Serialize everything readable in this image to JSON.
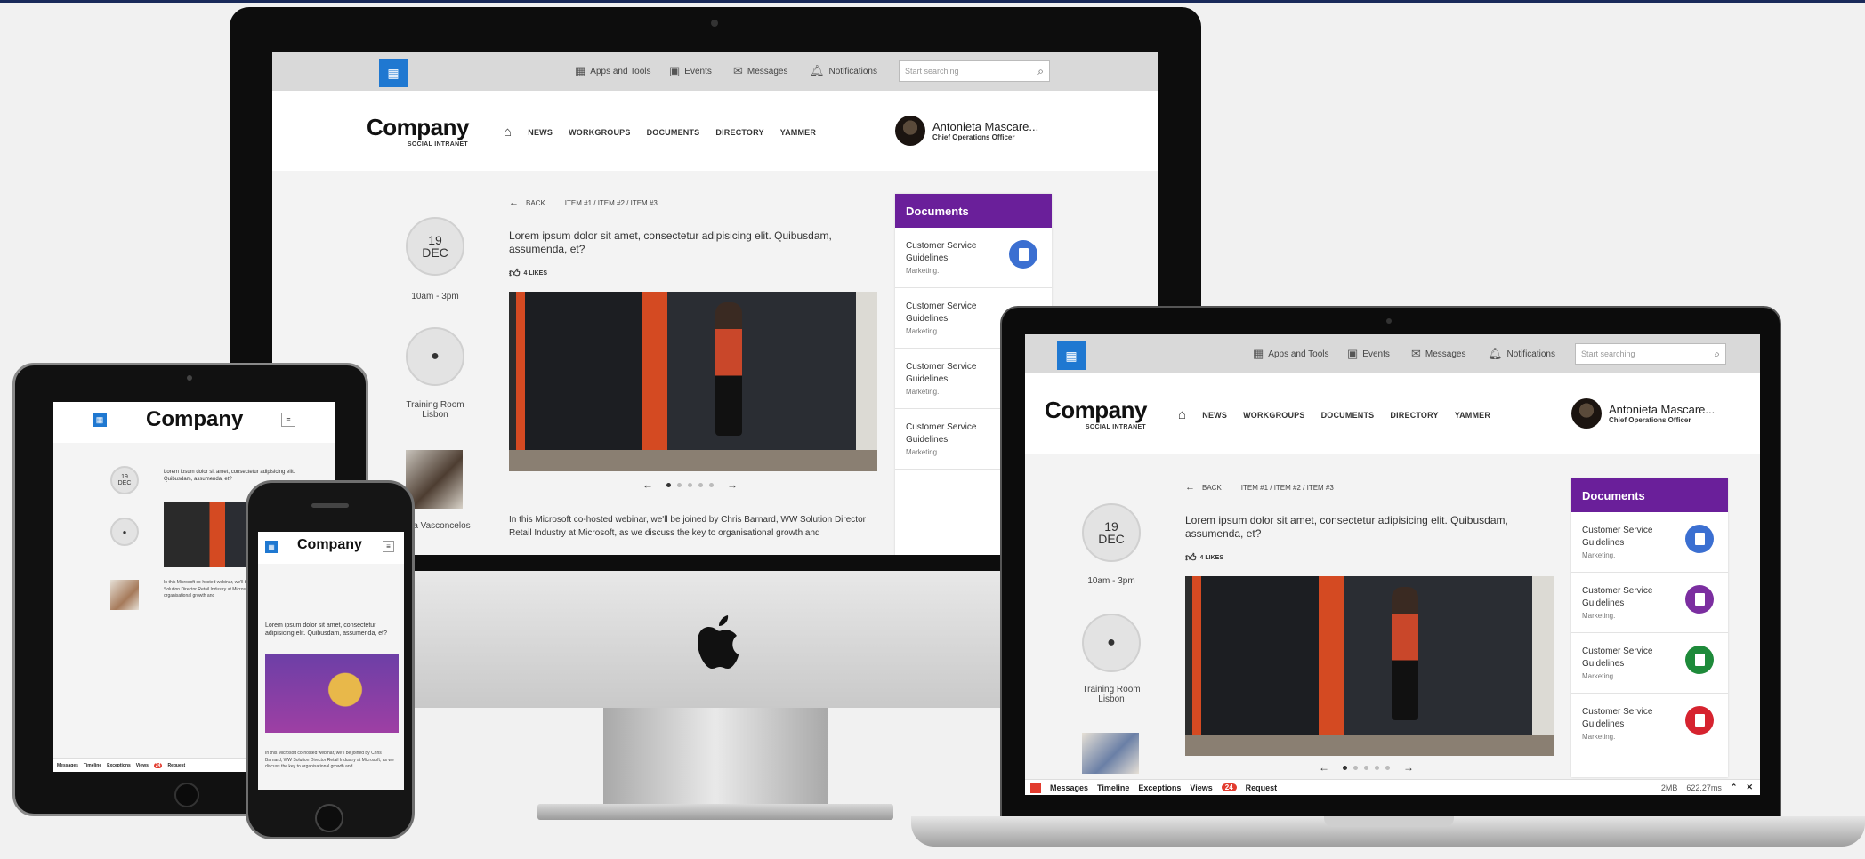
{
  "site": {
    "nav_util": {
      "apps_label": "Apps and Tools",
      "events_label": "Events",
      "messages_label": "Messages",
      "notifications_label": "Notifications",
      "search_placeholder": "Start searching"
    },
    "brand": {
      "title": "Company",
      "subtitle": "SOCIAL INTRANET"
    },
    "nav": [
      "NEWS",
      "WORKGROUPS",
      "DOCUMENTS",
      "DIRECTORY",
      "YAMMER"
    ],
    "profile": {
      "name": "Antonieta Mascare...",
      "role": "Chief Operations Officer"
    },
    "event": {
      "day": "19",
      "month": "DEC",
      "time": "10am - 3pm",
      "location": "Training Room\nLisbon"
    },
    "breadcrumb": {
      "back": "BACK",
      "path": "ITEM #1 / ITEM #2 / ITEM #3"
    },
    "headline": "Lorem ipsum dolor sit amet, consectetur adipisicing elit. Quibusdam, assumenda, et?",
    "likes": "4 LIKES",
    "body_text": "In this Microsoft co-hosted webinar, we'll be joined by Chris Barnard, WW Solution Director Retail Industry at Microsoft, as we discuss the key to organisational growth and",
    "person_partial": "ata Vasconcelos",
    "documents": {
      "title": "Documents",
      "items": [
        {
          "title": "Customer Service Guidelines",
          "category": "Marketing.",
          "color": "#3b6fd1"
        },
        {
          "title": "Customer Service Guidelines",
          "category": "Marketing.",
          "color": "#7b2ea0"
        },
        {
          "title": "Customer Service Guidelines",
          "category": "Marketing.",
          "color": "#1e8a3a"
        },
        {
          "title": "Customer Service Guidelines",
          "category": "Marketing.",
          "color": "#d6232f"
        }
      ]
    },
    "debug": {
      "messages": "Messages",
      "timeline": "Timeline",
      "exceptions": "Exceptions",
      "views": "Views",
      "views_count": "24",
      "request": "Request",
      "memory": "2MB",
      "time": "622.27ms"
    }
  },
  "accent_colors": {
    "grid_button": "#1f78d1",
    "documents_header": "#6a1f9a",
    "badge": "#e23b2e"
  }
}
